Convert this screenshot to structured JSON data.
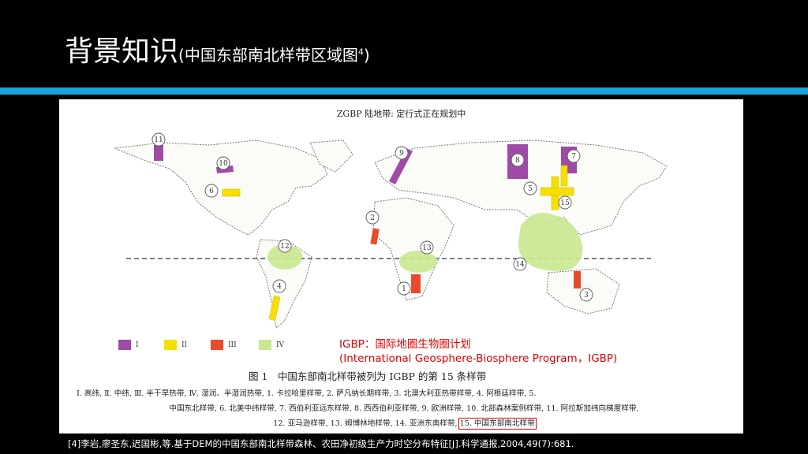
{
  "slide": {
    "title_main": "背景知识",
    "title_sub": "(中国东部南北样带区域图",
    "title_sup": "4",
    "title_close": ")",
    "reference": "[4]李岩,廖圣东,迟国彬,等.基于DEM的中国东部南北样带森林、农田净初级生产力时空分布特征[J].科学通报,2004,49(7):681."
  },
  "figure": {
    "map_title": "ZGBP 陆地带: 定行式正在规划中",
    "transect_markers": [
      "1",
      "2",
      "3",
      "4",
      "5",
      "6",
      "7",
      "8",
      "9",
      "10",
      "11",
      "12",
      "13",
      "14",
      "15"
    ],
    "legend": [
      {
        "label": "I",
        "color": "#a04aa8"
      },
      {
        "label": "II",
        "color": "#f5e000"
      },
      {
        "label": "III",
        "color": "#ea4a2c"
      },
      {
        "label": "IV",
        "color": "#c8e890"
      }
    ],
    "igbp_note_line1": "IGBP：国际地圈生物圈计划",
    "igbp_note_line2": "(International Geosphere-Biosphere Program，IGBP)",
    "caption": "图 1　中国东部南北样带被列为 IGBP 的第 15 条样带",
    "list_line1": "Ⅰ. 高纬, Ⅱ. 中纬, Ⅲ. 半干旱热带, Ⅳ. 湿润、半湿润热带, 1. 卡拉哈里样带, 2. 萨凡纳长期样带, 3. 北澳大利亚热带样带, 4. 阿根廷样带, 5.",
    "list_line2": "中国东北样带, 6. 北美中纬样带, 7. 西伯利亚远东样带, 8. 西西伯利亚样带, 9. 欧洲样带, 10. 北部森林案例样带, 11. 阿拉斯加纬向梯度样带,",
    "list_line3_a": "12. 亚马逊样带, 13. 姆博林地样带, 14. 亚洲东南样带,",
    "list_line3_b": "15. 中国东部南北样带"
  },
  "colors": {
    "accent_divider": "#1ba2d8",
    "highlight": "#e00000",
    "zone_I": "#a04aa8",
    "zone_II": "#f5e000",
    "zone_III": "#ea4a2c",
    "zone_IV": "#c8e890"
  }
}
